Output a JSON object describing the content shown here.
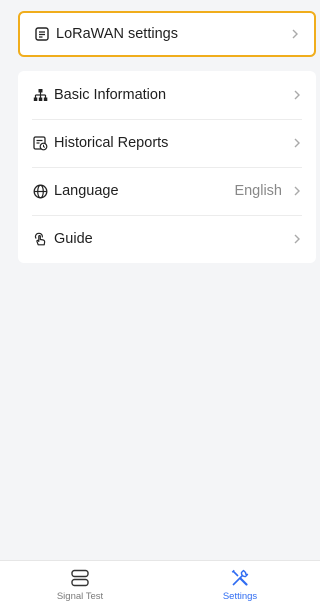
{
  "lorawan": {
    "label": "LoRaWAN settings",
    "icon": "document-list-icon",
    "chevron": "chevron-right-icon"
  },
  "menu": {
    "items": [
      {
        "label": "Basic Information",
        "icon": "sitemap-icon",
        "value": ""
      },
      {
        "label": "Historical Reports",
        "icon": "report-clock-icon",
        "value": ""
      },
      {
        "label": "Language",
        "icon": "globe-icon",
        "value": "English"
      },
      {
        "label": "Guide",
        "icon": "hand-pointer-icon",
        "value": ""
      }
    ]
  },
  "tabbar": {
    "tabs": [
      {
        "label": "Signal Test",
        "icon": "server-icon",
        "active": false
      },
      {
        "label": "Settings",
        "icon": "tools-icon",
        "active": true
      }
    ]
  },
  "colors": {
    "highlight_border": "#f0ad1c",
    "active_tab": "#2f6cf2",
    "background": "#f4f5f7"
  }
}
